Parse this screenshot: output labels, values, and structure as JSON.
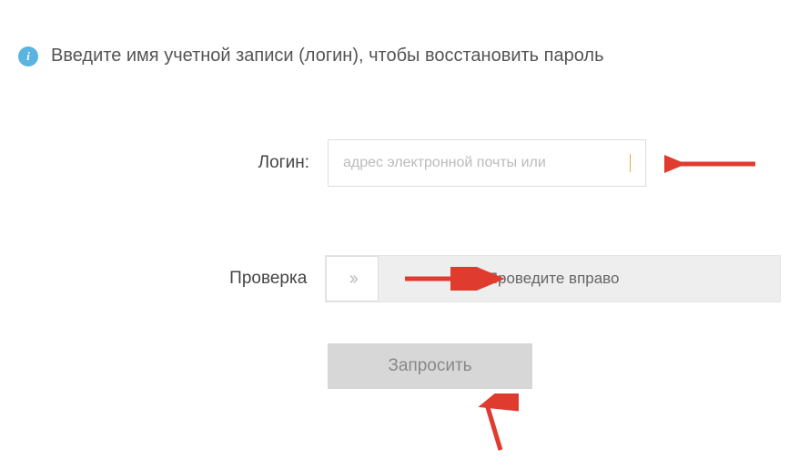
{
  "header": {
    "info_icon": "i",
    "text": "Введите имя учетной записи (логин), чтобы восстановить пароль"
  },
  "form": {
    "login": {
      "label": "Логин:",
      "placeholder": "адрес электронной почты или ",
      "value": ""
    },
    "verify": {
      "label": "Проверка",
      "handle_glyph": "››",
      "slide_text": "Проведите вправо"
    },
    "submit": {
      "label": "Запросить"
    }
  },
  "colors": {
    "info_icon_bg": "#5bb3e0",
    "annotation_arrow": "#e03b2f"
  }
}
